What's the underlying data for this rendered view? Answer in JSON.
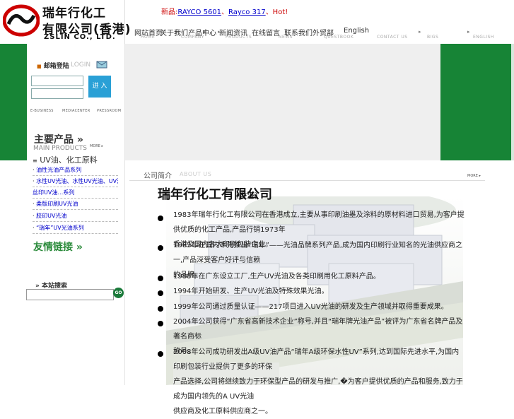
{
  "header": {
    "logo_line1": "瑞年行化工",
    "logo_line2": "有限公司(香港)",
    "logo_en": "ZSLIN CO., LTD.",
    "ticker_prefix": "新品:",
    "ticker_link1": "RAYCO 5601",
    "ticker_sep": "、",
    "ticker_link2": "Rayco 317",
    "ticker_suffix": "、Hot!"
  },
  "nav": [
    {
      "label": "网站首页",
      "en": "HOME"
    },
    {
      "label": "关于我们",
      "en": "COMPANY"
    },
    {
      "label": "产品中心",
      "en": "PRODUCTS"
    },
    {
      "label": "新闻资讯",
      "en": "NEWS"
    },
    {
      "label": "在线留言",
      "en": "QUESTBOOK"
    },
    {
      "label": "联系我们",
      "en": "CONTACT US"
    },
    {
      "label": "外贸部",
      "en": "BIGS"
    },
    {
      "label": "English",
      "en": "ENGLISH"
    }
  ],
  "login": {
    "title": "邮箱登陆",
    "title_en": "LOGIN",
    "submit": "进 入",
    "links": [
      "E-BUSINESS",
      "MEDIACENTER",
      "PRESSROOM"
    ]
  },
  "products": {
    "title": "主要产品 »",
    "title_en": "MAIN PRODUCTS",
    "more": "MORE ▸",
    "category": "UV油、化工原料",
    "items": [
      "油性光油产品系列",
      "水性UV光油、水性UV光油、UV油",
      "丝印UV油…系列",
      "柔版印刷UV光油",
      "胶印UV光油",
      "“瑞年”UV光油系列"
    ]
  },
  "friends": {
    "title": "友情链接 »"
  },
  "search": {
    "title": "» 本站搜索",
    "go": "GO"
  },
  "about": {
    "title": "公司简介",
    "title_en": "ABOUT US",
    "more": "MORE ▸",
    "company": "瑞年行化工有限公司",
    "company_sub": "(香港)",
    "history": [
      "1983年瑞年行化工有限公司在香港成立,主要从事印刷油墨及涂料的原材料进口贸易,为客户提供优质的化工产品,产品行销1973年",
      "香港及国内各大印刷包装企业。",
      "1985年在国内率先推出“瑞年”——光油品牌系列产品,成为国内印刷行业知名的光油供应商之一,产品深受客户好评与信赖",
      "的品牌。",
      "1988年在广东设立工厂,生产UV光油及各类印刷用化工原料产品。",
      "1994年开始研发、生产UV光油及特殊效果光油。",
      "1999年公司通过质量认证——217项目进入UV光油的研发及生产领域并取得重要成果。",
      "2004年公司获得“广东省高新技术企业”称号,并且“瑞年牌光油产品”被评为广东省名牌产品及著名商标",
      "称号。",
      "2008年公司成功研发出A级UV油产品“瑞年A级环保水性UV”系列,达到国际先进水平,为国内印刷包装行业提供了更多的环保",
      "产品选择,公司将继续致力于环保型产品的研发与推广,�为客户提供优质的产品和服务,致力于成为国内领先的A UV光油",
      "供应商及化工原料供应商之一。"
    ]
  },
  "colors": {
    "green": "#178436",
    "link": "#0000cc",
    "hot": "#cc0000",
    "button": "#2aa0d6"
  }
}
